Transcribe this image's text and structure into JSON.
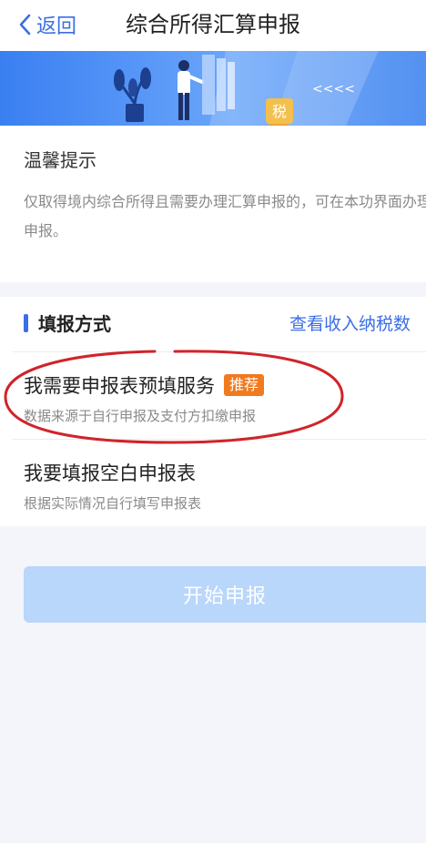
{
  "nav": {
    "back_label": "返回",
    "title": "综合所得汇算申报"
  },
  "banner": {
    "badge_text": "税",
    "arrows_text": "<<<<"
  },
  "tip": {
    "title": "温馨提示",
    "body": "仅取得境内综合所得且需要办理汇算申报的，可在本功界面办理申报。"
  },
  "section": {
    "title": "填报方式",
    "link_label": "查看收入纳税数"
  },
  "options": [
    {
      "title": "我需要申报表预填服务",
      "badge": "推荐",
      "subtitle": "数据来源于自行申报及支付方扣缴申报"
    },
    {
      "title": "我要填报空白申报表",
      "subtitle": "根据实际情况自行填写申报表"
    }
  ],
  "submit": {
    "label": "开始申报",
    "state": "disabled"
  },
  "colors": {
    "accent": "#3b6ee6",
    "badge": "#f07a1e",
    "annotation_circle": "#d0242b",
    "button_disabled": "#b9d6fb"
  }
}
